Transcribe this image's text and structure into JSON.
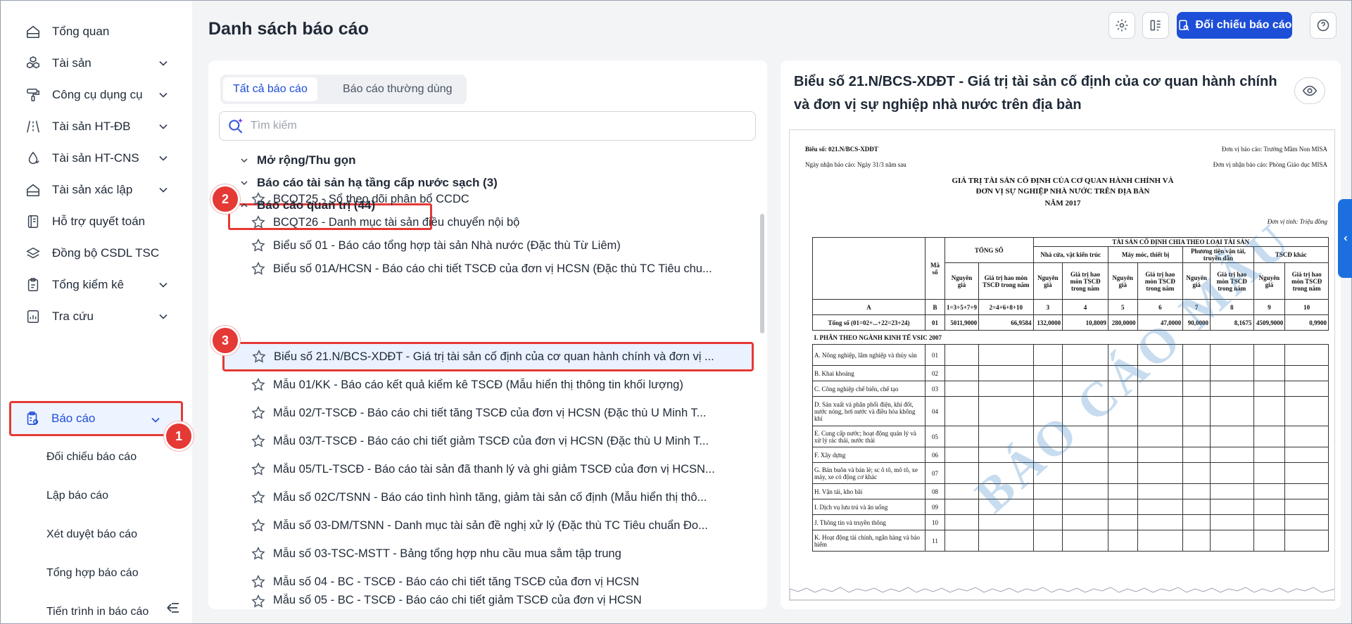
{
  "sidebar": {
    "items": [
      {
        "label": "Tổng quan",
        "icon": "home-icon",
        "has_chevron": false
      },
      {
        "label": "Tài sản",
        "icon": "cubes-icon",
        "has_chevron": true
      },
      {
        "label": "Công cụ dụng cụ",
        "icon": "paint-roller-icon",
        "has_chevron": true
      },
      {
        "label": "Tài sản HT-ĐB",
        "icon": "road-icon",
        "has_chevron": true
      },
      {
        "label": "Tài sản HT-CNS",
        "icon": "water-drop-icon",
        "has_chevron": true
      },
      {
        "label": "Tài sản xác lập",
        "icon": "house-icon",
        "has_chevron": true
      },
      {
        "label": "Hỗ trợ quyết toán",
        "icon": "document-icon",
        "has_chevron": false
      },
      {
        "label": "Đồng bộ CSDL TSC",
        "icon": "layers-icon",
        "has_chevron": false
      },
      {
        "label": "Tổng kiểm kê",
        "icon": "clipboard-icon",
        "has_chevron": true
      },
      {
        "label": "Tra cứu",
        "icon": "chart-icon",
        "has_chevron": true
      },
      {
        "label": "Báo cáo",
        "icon": "report-icon",
        "has_chevron": true,
        "active": true
      }
    ],
    "sub_items": [
      "Đối chiếu báo cáo",
      "Lập báo cáo",
      "Xét duyệt báo cáo",
      "Tổng hợp báo cáo",
      "Tiến trình in báo cáo"
    ]
  },
  "badges": [
    "1",
    "2",
    "3"
  ],
  "header": {
    "title": "Danh sách báo cáo",
    "primary_button": "Đối chiếu báo cáo"
  },
  "left_panel": {
    "tabs": [
      "Tất cả báo cáo",
      "Báo cáo thường dùng"
    ],
    "search_placeholder": "Tìm kiếm",
    "expand_collapse": "Mở rộng/Thu gọn",
    "group_1": "Báo cáo tài sản hạ tầng cấp nước sạch (3)",
    "group_2": "Báo cáo quản trị (44)",
    "reports": [
      "BCQT25 - Sổ theo dõi phân bổ CCDC",
      "BCQT26 - Danh mục tài sản điều chuyển nội bộ",
      "Biểu số 01 - Báo cáo tổng hợp tài sản Nhà nước (Đặc thù Từ Liêm)",
      "Biểu số 01A/HCSN - Báo cáo chi tiết TSCĐ của đơn vị HCSN (Đặc thù TC Tiêu chu...",
      "Biểu số 21.N/BCS-XDĐT - Giá trị tài sản cố định của cơ quan hành chính và đơn vị ...",
      "Mẫu 01/KK - Báo cáo kết quả kiểm kê TSCĐ (Mẫu hiển thị thông tin khối lượng)",
      "Mẫu 02/T-TSCĐ - Báo cáo chi tiết tăng TSCĐ của đơn vị HCSN (Đặc thù U Minh T...",
      "Mẫu 03/T-TSCĐ - Báo cáo chi tiết giảm TSCĐ của đơn vị HCSN (Đặc thù U Minh T...",
      "Mẫu 05/TL-TSCĐ - Báo cáo tài sản đã thanh lý và ghi giảm TSCĐ của đơn vị HCSN...",
      "Mẫu số 02C/TSNN - Báo cáo tình hình tăng, giảm tài sản cố định (Mẫu hiển thị thô...",
      "Mẫu số 03-DM/TSNN - Danh mục tài sản đề nghị xử lý (Đặc thù TC Tiêu chuẩn Đo...",
      "Mẫu số 03-TSC-MSTT - Bảng tổng hợp nhu cầu mua sắm tập trung",
      "Mẫu số 04 - BC - TSCĐ - Báo cáo chi tiết tăng TSCĐ của đơn vị HCSN",
      "Mẫu số 05 - BC - TSCĐ - Báo cáo chi tiết giảm TSCĐ của đơn vị HCSN"
    ]
  },
  "right_panel": {
    "title": "Biểu số 21.N/BCS-XDĐT - Giá trị tài sản cố định của cơ quan hành chính và đơn vị sự nghiệp nhà nước trên địa bàn",
    "doc": {
      "form_code": "Biểu số: 021.N/BCS-XDĐT",
      "receive_date": "Ngày nhận báo cáo: Ngày 31/3 năm sau",
      "reporting_unit": "Đơn vị báo cáo: Trường Mầm Non MISA",
      "receiving_unit": "Đơn vị nhận báo cáo: Phòng Giáo dục MISA",
      "title_1": "GIÁ TRỊ TÀI SẢN CỐ ĐỊNH CỦA CƠ QUAN HÀNH CHÍNH VÀ",
      "title_2": "ĐƠN VỊ SỰ NGHIỆP NHÀ NƯỚC TRÊN ĐỊA BÀN",
      "year": "NĂM 2017",
      "unit": "Đơn vị tính: Triệu đồng",
      "h_code": "Mã số",
      "h_total": "TỔNG SỐ",
      "h_by_type": "TÀI SẢN CỐ ĐỊNH CHIA THEO LOẠI TÀI SẢN",
      "h_types": [
        "Nhà cửa, vật kiến trúc",
        "Máy móc, thiết bị",
        "Phương tiện vận tải, truyền dẫn",
        "TSCĐ khác"
      ],
      "h_orig": "Nguyên giá",
      "h_dep": "Giá trị hao mòn TSCĐ trong năm",
      "letter_row": [
        "A",
        "B",
        "1=3+5+7+9",
        "2=4+6+8+10",
        "3",
        "4",
        "5",
        "6",
        "7",
        "8",
        "9",
        "10"
      ],
      "total_row": [
        "Tổng số (01=02+...+22=23+24)",
        "01",
        "5011,9000",
        "66,9584",
        "132,0000",
        "10,8009",
        "280,0000",
        "47,0000",
        "90,0000",
        "8,1675",
        "4509,9000",
        "0,9900"
      ],
      "section": "I. PHÂN THEO NGÀNH KINH TẾ VSIC 2007",
      "rows": [
        [
          "A. Nông nghiệp, lâm nghiệp và thủy sản",
          "01"
        ],
        [
          "B. Khai khoáng",
          "02"
        ],
        [
          "C. Công nghiệp chế biến, chế tạo",
          "03"
        ],
        [
          "D. Sản xuất và phân phối điện, khí đốt, nước nóng, hơi nước và điều hòa không khí",
          "04"
        ],
        [
          "E. Cung cấp nước; hoạt động quản lý và xử lý rác thải, nước thải",
          "05"
        ],
        [
          "F. Xây dựng",
          "06"
        ],
        [
          "G. Bán buôn và bán lẻ; sc ô tô, mô tô, xe máy, xe có động cơ khác",
          "07"
        ],
        [
          "H. Vận tải, kho bãi",
          "08"
        ],
        [
          "I. Dịch vụ lưu trú và ăn uống",
          "09"
        ],
        [
          "J. Thông tin và truyền thông",
          "10"
        ],
        [
          "K. Hoạt động tài chính, ngân hàng và bảo hiểm",
          "11"
        ]
      ],
      "watermark": "BÁO CÁO MẪU"
    }
  },
  "colors": {
    "accent": "#1d4ed8",
    "highlight": "#e53935",
    "selected_bg": "#eaf1ff"
  }
}
